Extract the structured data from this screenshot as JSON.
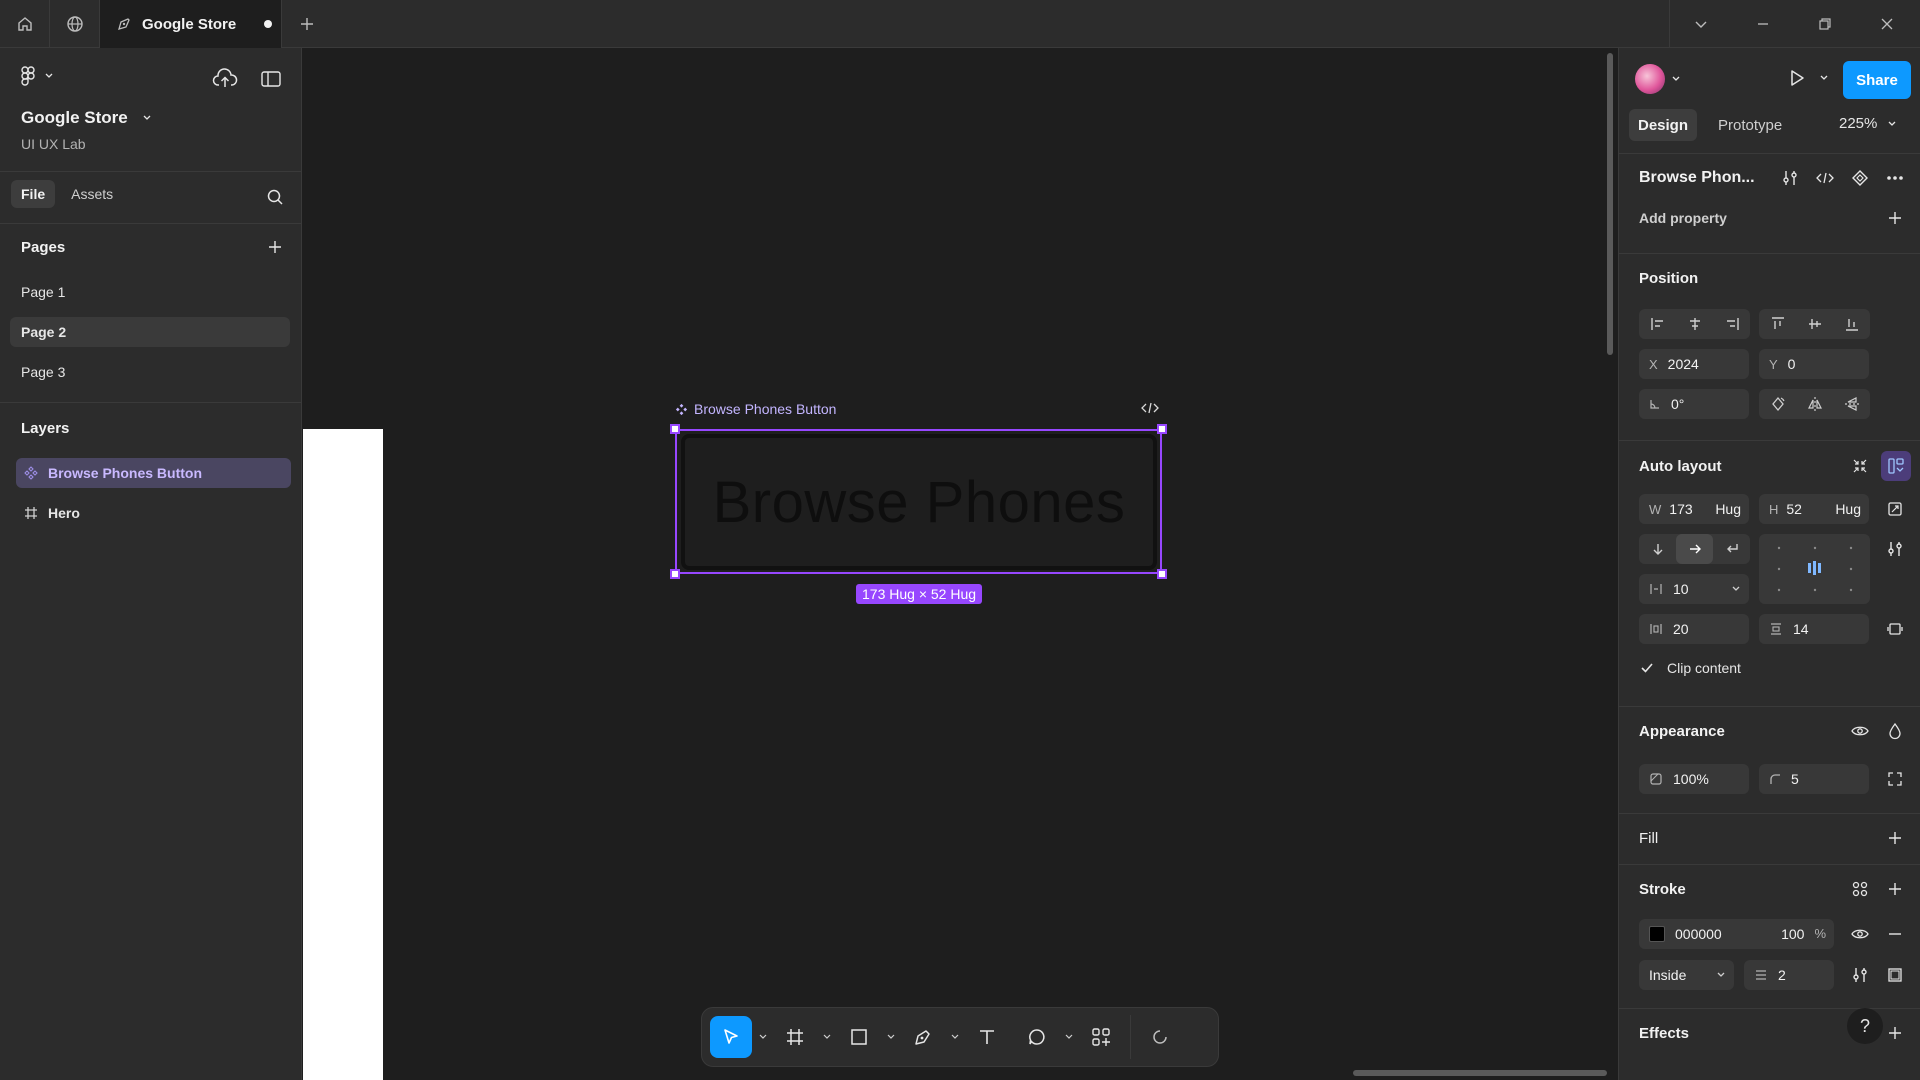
{
  "titlebar": {
    "tab_title": "Google Store",
    "icons": [
      "home-icon",
      "globe-icon",
      "design-file-icon",
      "plus-icon",
      "chevron-down-icon",
      "minimize-icon",
      "restore-icon",
      "close-icon"
    ]
  },
  "left_panel": {
    "project_name": "Google Store",
    "team_name": "UI UX Lab",
    "tabs": [
      "File",
      "Assets"
    ],
    "pages_heading": "Pages",
    "pages": [
      "Page 1",
      "Page 2",
      "Page 3"
    ],
    "selected_page": "Page 2",
    "layers_heading": "Layers",
    "layers": [
      {
        "label": "Browse Phones Button",
        "icon": "component-icon"
      },
      {
        "label": "Hero",
        "icon": "frame-hash-icon"
      }
    ]
  },
  "canvas": {
    "component_label": "Browse Phones Button",
    "button_text": "Browse Phones",
    "size_badge": "173 Hug × 52 Hug",
    "selection_color": "#9747ff"
  },
  "toolbar": {
    "tools": [
      "move-tool",
      "frame-tool",
      "rectangle-tool",
      "pen-tool",
      "text-tool",
      "comment-tool",
      "actions-tool",
      "dev-mode-tool"
    ],
    "active_tool": "move-tool",
    "accent": "#0d99ff"
  },
  "right_panel": {
    "share_label": "Share",
    "tabs": [
      "Design",
      "Prototype"
    ],
    "zoom": "225%",
    "layer_name": "Browse Phon...",
    "add_property": "Add property",
    "position": {
      "heading": "Position",
      "x_label": "X",
      "x": "2024",
      "y_label": "Y",
      "y": "0",
      "rotation": "0°"
    },
    "auto_layout": {
      "heading": "Auto layout",
      "w_label": "W",
      "w": "173",
      "w_mode": "Hug",
      "h_label": "H",
      "h": "52",
      "h_mode": "Hug",
      "gap": "10",
      "pad_h": "20",
      "pad_v": "14",
      "clip_content": "Clip content"
    },
    "appearance": {
      "heading": "Appearance",
      "opacity": "100%",
      "radius": "5"
    },
    "fill": {
      "heading": "Fill"
    },
    "stroke": {
      "heading": "Stroke",
      "color_hex": "000000",
      "opacity": "100",
      "percent": "%",
      "position": "Inside",
      "weight": "2"
    },
    "effects": {
      "heading": "Effects"
    },
    "help": "?"
  }
}
